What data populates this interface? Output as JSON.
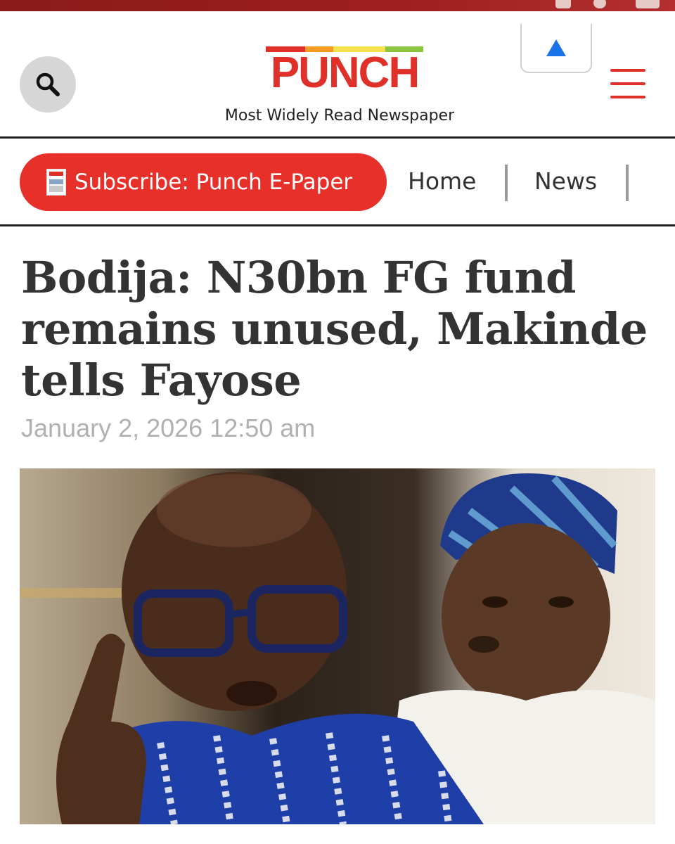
{
  "header": {
    "logo_text": "PUNCH",
    "tagline": "Most Widely Read Newspaper"
  },
  "nav": {
    "subscribe_label": "Subscribe: Punch E-Paper",
    "items": [
      {
        "label": "Home"
      },
      {
        "label": "News"
      }
    ]
  },
  "article": {
    "headline": "Bodija: N30bn FG fund remains unused, Makinde tells Fayose",
    "date": "January 2, 2026 12:50 am"
  },
  "colors": {
    "brand_red": "#e0302a",
    "accent_blue": "#1a73e8"
  },
  "icons": [
    "search-icon",
    "arrow-up-icon",
    "hamburger-menu-icon",
    "newspaper-icon"
  ]
}
